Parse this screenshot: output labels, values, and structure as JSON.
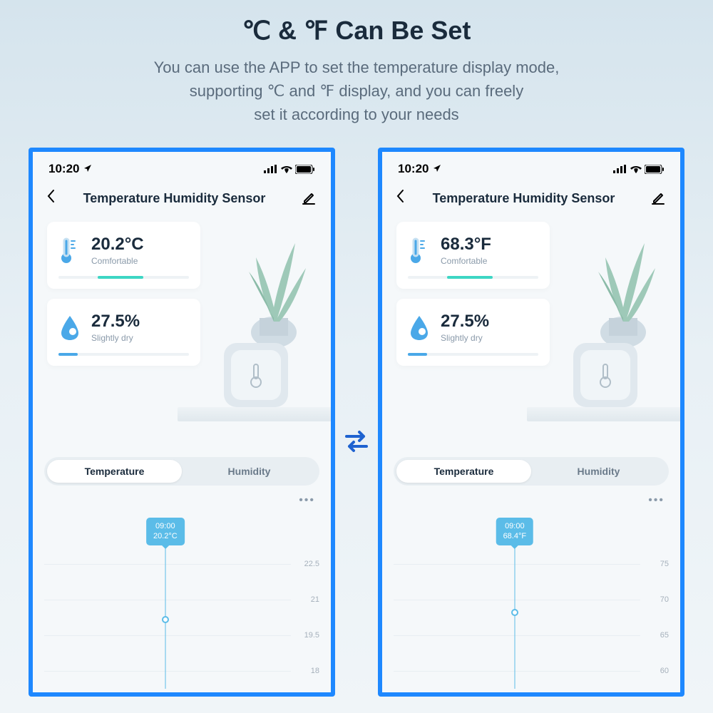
{
  "heading": {
    "title": "℃ & ℉ Can Be Set",
    "subtitle_line1": "You can use the APP to set the temperature display mode,",
    "subtitle_line2": "supporting ℃ and ℉ display, and you can freely",
    "subtitle_line3": "set it according to your needs"
  },
  "statusbar": {
    "time": "10:20"
  },
  "nav": {
    "title": "Temperature Humidity Sensor"
  },
  "left": {
    "temp": {
      "value": "20.2°C",
      "label": "Comfortable"
    },
    "humidity": {
      "value": "27.5%",
      "label": "Slightly dry"
    },
    "tabs": {
      "temperature": "Temperature",
      "humidity": "Humidity"
    },
    "chart": {
      "tooltip_time": "09:00",
      "tooltip_value": "20.2°C",
      "ylabels": [
        "22.5",
        "21",
        "19.5",
        "18"
      ]
    }
  },
  "right": {
    "temp": {
      "value": "68.3°F",
      "label": "Comfortable"
    },
    "humidity": {
      "value": "27.5%",
      "label": "Slightly dry"
    },
    "tabs": {
      "temperature": "Temperature",
      "humidity": "Humidity"
    },
    "chart": {
      "tooltip_time": "09:00",
      "tooltip_value": "68.4°F",
      "ylabels": [
        "75",
        "70",
        "65",
        "60"
      ]
    }
  },
  "colors": {
    "accent_blue": "#1e88ff",
    "chart_blue": "#5bbce8",
    "temp_bar": "#3dd6c4",
    "humid_bar": "#4aa8e8"
  }
}
